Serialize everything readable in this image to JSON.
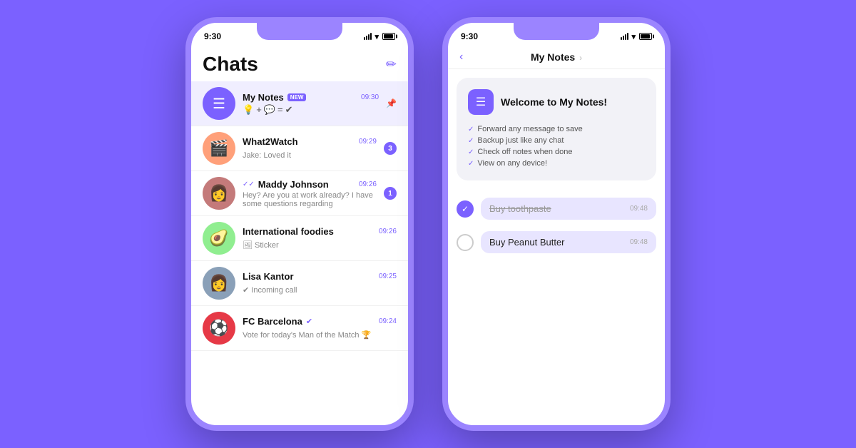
{
  "background": "#7B61FF",
  "left_phone": {
    "status_time": "9:30",
    "header": {
      "title": "Chats",
      "compose_label": "✏"
    },
    "chats": [
      {
        "id": "my-notes",
        "name": "My Notes",
        "badge": "NEW",
        "time": "09:30",
        "preview_type": "emoji",
        "preview": "💡 + 💬 = ✔",
        "avatar_type": "icon",
        "avatar_icon": "☰",
        "active": true,
        "has_pin": true
      },
      {
        "id": "what2watch",
        "name": "What2Watch",
        "time": "09:29",
        "preview": "Jake: Loved it",
        "avatar_type": "emoji",
        "avatar_emoji": "🎬",
        "unread": 3
      },
      {
        "id": "maddy-johnson",
        "name": "Maddy Johnson",
        "time": "09:26",
        "preview": "Hey? Are you at work already? I have some questions regarding",
        "avatar_type": "person",
        "avatar_color": "#c47a7a",
        "double_check": true,
        "unread": 1
      },
      {
        "id": "international-foodies",
        "name": "International foodies",
        "time": "09:26",
        "preview": "🖼 Sticker",
        "avatar_type": "emoji",
        "avatar_emoji": "🥑"
      },
      {
        "id": "lisa-kantor",
        "name": "Lisa Kantor",
        "time": "09:25",
        "preview": "✔ Incoming call",
        "avatar_type": "person",
        "avatar_color": "#8aa0b8",
        "single_check": true
      },
      {
        "id": "fc-barcelona",
        "name": "FC Barcelona",
        "time": "09:24",
        "preview": "Vote for today's Man of the Match 🏆",
        "avatar_type": "emoji",
        "avatar_emoji": "⚽",
        "avatar_color": "#e63946",
        "verified": true
      }
    ]
  },
  "right_phone": {
    "status_time": "9:30",
    "header": {
      "title": "My Notes",
      "chevron": "›",
      "back_label": "‹"
    },
    "welcome_card": {
      "icon": "☰",
      "title": "Welcome to My Notes!",
      "items": [
        "Forward any message to save",
        "Backup just like any chat",
        "Check off notes when done",
        "View on any device!"
      ]
    },
    "notes": [
      {
        "id": "buy-toothpaste",
        "text": "Buy toothpaste",
        "time": "09:48",
        "done": true
      },
      {
        "id": "buy-peanut-butter",
        "text": "Buy Peanut Butter",
        "time": "09:48",
        "done": false
      }
    ]
  }
}
